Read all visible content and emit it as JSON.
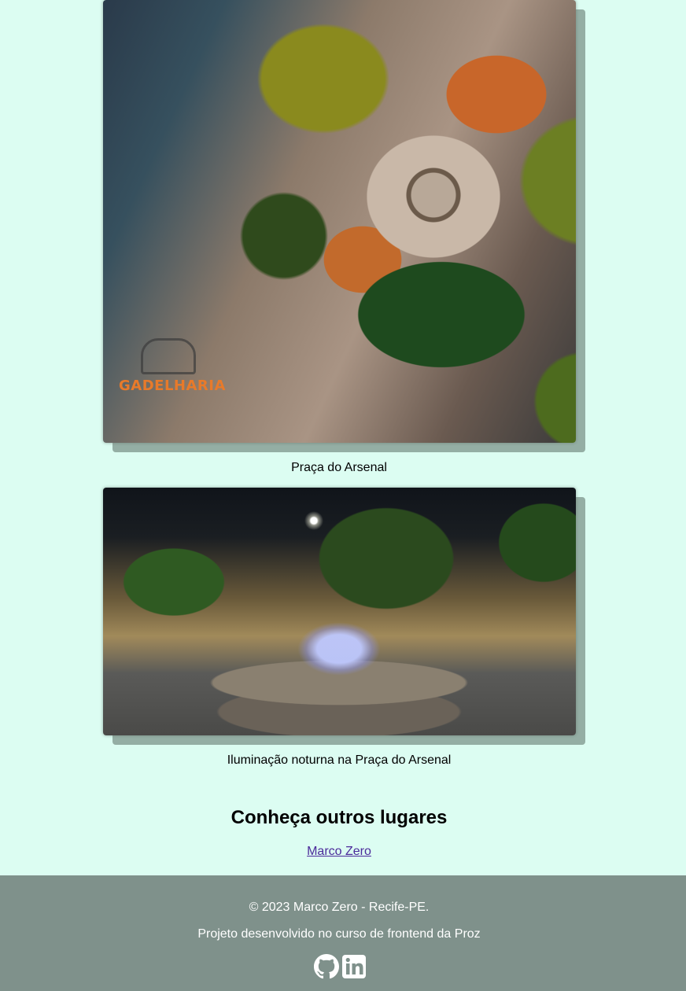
{
  "gallery": [
    {
      "caption": "Praça do Arsenal",
      "watermark": "GADELHARIA",
      "image": "aerial view of a circular square with trees and a fountain"
    },
    {
      "caption": "Iluminação noturna na Praça do Arsenal",
      "image": "illuminated fountain in the square at night"
    }
  ],
  "other_places": {
    "title": "Conheça outros lugares",
    "links": [
      {
        "label": "Marco Zero"
      }
    ]
  },
  "footer": {
    "copyright": "© 2023 Marco Zero - Recife-PE.",
    "credit": "Projeto desenvolvido no curso de frontend da Proz",
    "social": [
      {
        "icon": "github-icon"
      },
      {
        "icon": "linkedin-icon"
      }
    ]
  },
  "colors": {
    "page_background": "#dcfdf2",
    "footer_background": "#7f918b",
    "link": "#4b2a9b"
  }
}
